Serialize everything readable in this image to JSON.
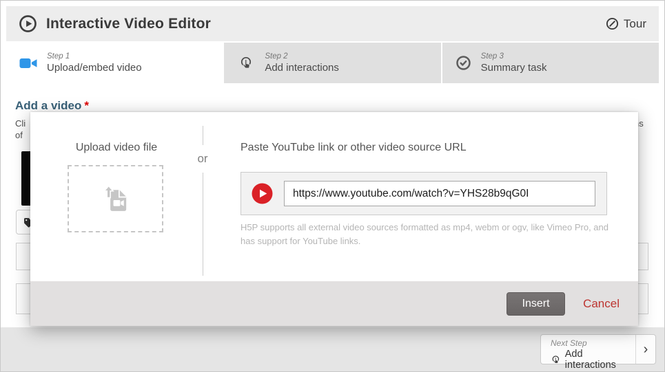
{
  "header": {
    "title": "Interactive Video Editor",
    "tour_label": "Tour"
  },
  "tabs": [
    {
      "step": "Step 1",
      "label": "Upload/embed video",
      "active": true
    },
    {
      "step": "Step 2",
      "label": "Add interactions",
      "active": false
    },
    {
      "step": "Step 3",
      "label": "Summary task",
      "active": false
    }
  ],
  "background_form": {
    "heading": "Add a video",
    "required_mark": "*",
    "description_fragments": {
      "line1_start": "Cli",
      "line2_start": "of",
      "line1_end": "ns"
    }
  },
  "modal": {
    "upload_section_title": "Upload video file",
    "or_label": "or",
    "paste_section_title": "Paste YouTube link or other video source URL",
    "url_input_value": "https://www.youtube.com/watch?v=YHS28b9qG0I",
    "helper_text": "H5P supports all external video sources formatted as mp4, webm or ogv, like Vimeo Pro, and has support for YouTube links.",
    "insert_label": "Insert",
    "cancel_label": "Cancel"
  },
  "next_step": {
    "eyebrow": "Next Step",
    "label": "Add interactions"
  },
  "icons": {
    "chevron_right": "›"
  },
  "colors": {
    "accent_blue": "#2f96e8",
    "youtube_red": "#da2127",
    "cancel_red": "#bd3430",
    "heading_blue": "#3a6279",
    "required_red": "#dd0000",
    "header_bg": "#ededed",
    "tab_inactive_bg": "#e0e0e0",
    "modal_footer_bg": "#e2e0e0",
    "page_bottom_bg": "#e5e5e5",
    "insert_button_bg": "#6e6a6a"
  }
}
